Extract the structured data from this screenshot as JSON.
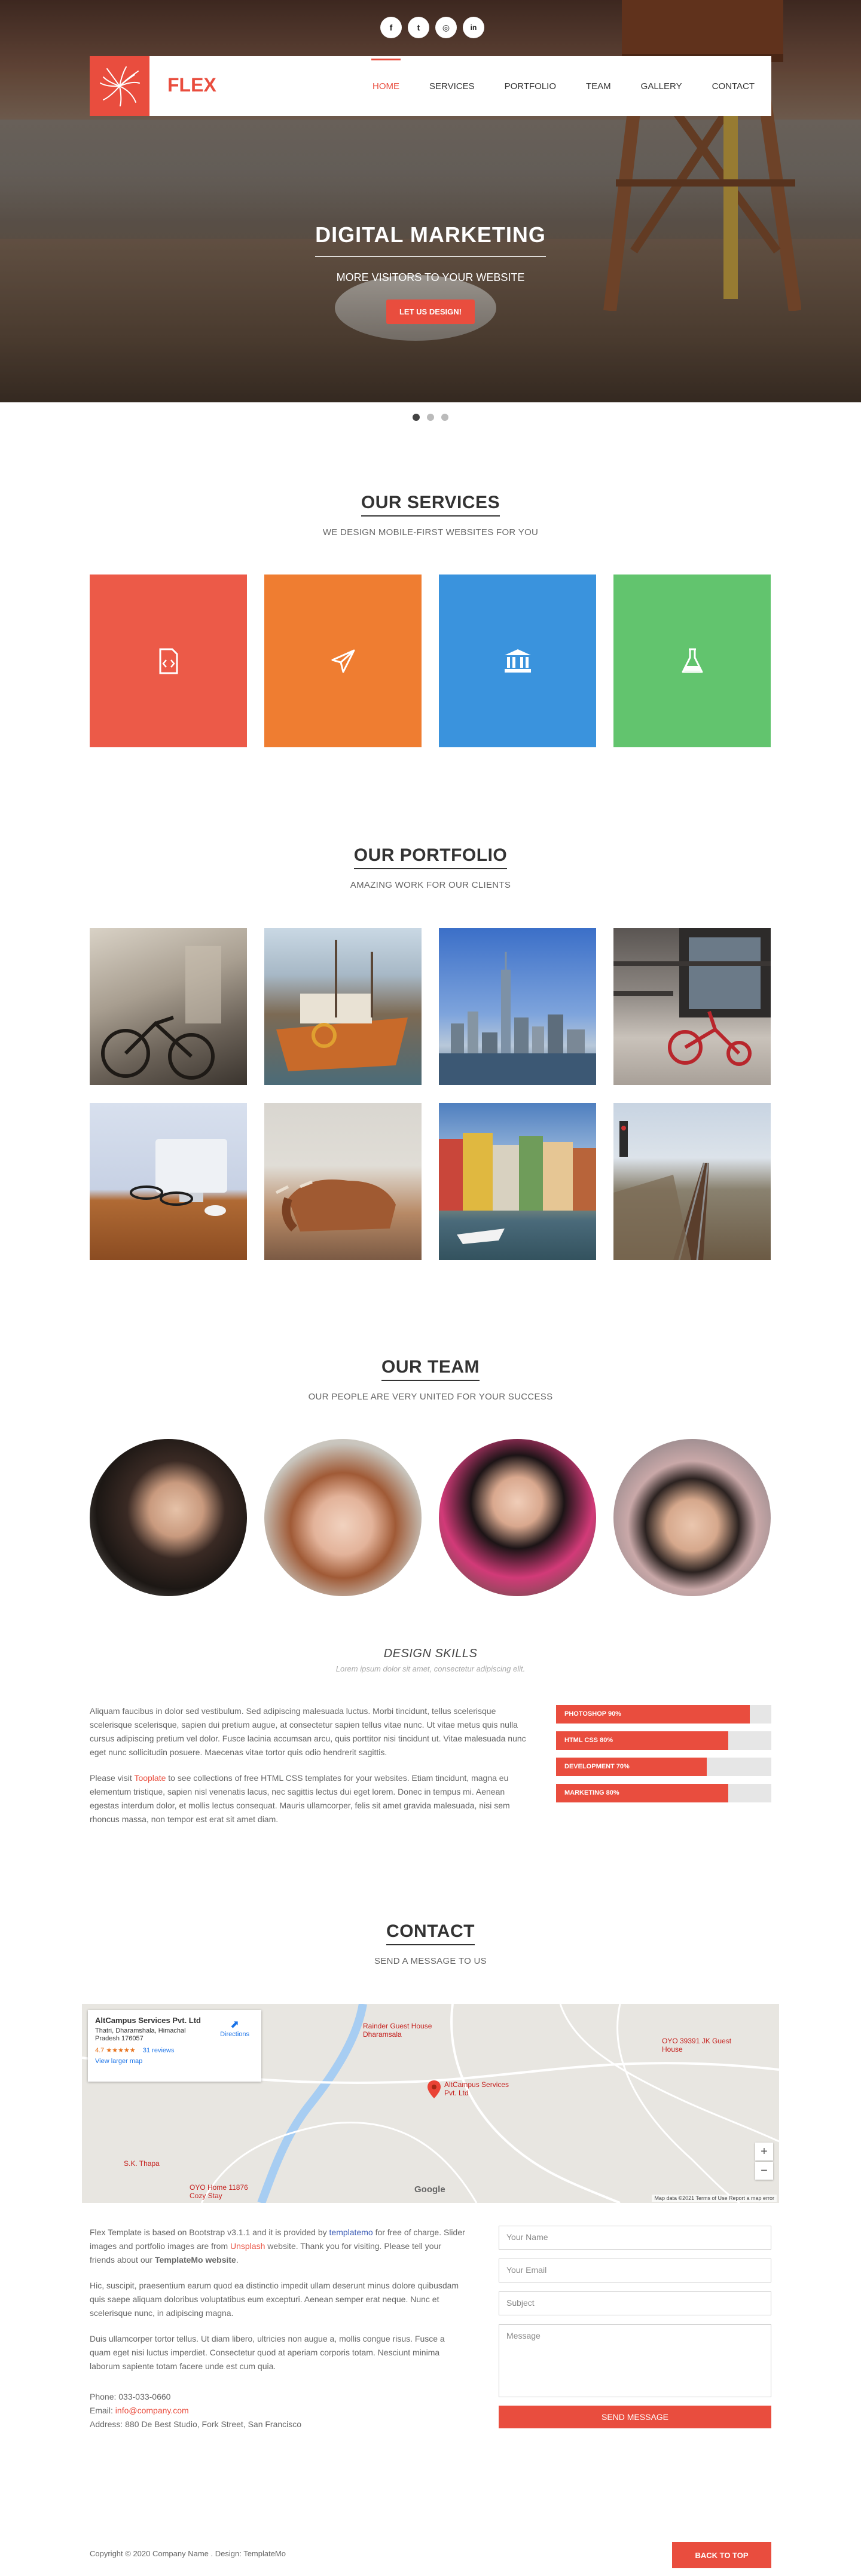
{
  "social": [
    {
      "icon": "facebook-icon",
      "glyph": "f"
    },
    {
      "icon": "twitter-icon",
      "glyph": "t"
    },
    {
      "icon": "dribbble-icon",
      "glyph": "◎"
    },
    {
      "icon": "linkedin-icon",
      "glyph": "in"
    }
  ],
  "nav": {
    "brand": "FLEX",
    "items": [
      "HOME",
      "SERVICES",
      "PORTFOLIO",
      "TEAM",
      "GALLERY",
      "CONTACT"
    ],
    "active": "HOME"
  },
  "hero": {
    "title": "DIGITAL MARKETING",
    "subtitle": "MORE VISITORS TO YOUR WEBSITE",
    "button": "LET US DESIGN!",
    "slides": 3,
    "active_slide": 1
  },
  "services": {
    "title": "OUR SERVICES",
    "subtitle": "WE DESIGN MOBILE-FIRST WEBSITES FOR YOU",
    "tiles": [
      {
        "icon": "code-file-icon",
        "color": "#ec5a48"
      },
      {
        "icon": "paper-plane-icon",
        "color": "#ef7d31"
      },
      {
        "icon": "bank-icon",
        "color": "#3a93dd"
      },
      {
        "icon": "flask-icon",
        "color": "#62c46e"
      }
    ]
  },
  "portfolio": {
    "title": "OUR PORTFOLIO",
    "subtitle": "AMAZING WORK FOR OUR CLIENTS"
  },
  "team": {
    "title": "OUR TEAM",
    "subtitle": "OUR PEOPLE ARE VERY UNITED FOR YOUR SUCCESS"
  },
  "skills": {
    "title": "DESIGN SKILLS",
    "subtitle": "Lorem ipsum dolor sit amet, consectetur adipiscing elit.",
    "para1": "Aliquam faucibus in dolor sed vestibulum. Sed adipiscing malesuada luctus. Morbi tincidunt, tellus scelerisque scelerisque scelerisque, sapien dui pretium augue, at consectetur sapien tellus vitae nunc. Ut vitae metus quis nulla cursus adipiscing pretium vel dolor. Fusce lacinia accumsan arcu, quis porttitor nisi tincidunt ut. Vitae malesuada nunc eget nunc sollicitudin posuere. Maecenas vitae tortor quis odio hendrerit sagittis.",
    "para2_pre": "Please visit ",
    "para2_link": "Tooplate",
    "para2_post": " to see collections of free HTML CSS templates for your websites. Etiam tincidunt, magna eu elementum tristique, sapien nisl venenatis lacus, nec sagittis lectus dui eget lorem. Donec in tempus mi. Aenean egestas interdum dolor, et mollis lectus consequat. Mauris ullamcorper, felis sit amet gravida malesuada, nisi sem rhoncus massa, non tempor est erat sit amet diam.",
    "bars": [
      {
        "label": "PHOTOSHOP 90%",
        "value": 90
      },
      {
        "label": "HTML CSS 80%",
        "value": 80
      },
      {
        "label": "DEVELOPMENT 70%",
        "value": 70
      },
      {
        "label": "MARKETING 80%",
        "value": 80
      }
    ]
  },
  "contact": {
    "title": "CONTACT",
    "subtitle": "SEND A MESSAGE TO US",
    "map": {
      "place": "AltCampus Services Pvt. Ltd",
      "address": "Thatri, Dharamshala, Himachal Pradesh 176057",
      "rating": "4.7 ★★★★★",
      "reviews": "31 reviews",
      "larger": "View larger map",
      "directions": "Directions",
      "marker_label": "AltCampus Services Pvt. Ltd",
      "poi1": "Rainder Guest House Dharamsala",
      "poi2": "OYO 39391 JK Guest House",
      "poi3": "S.K. Thapa",
      "poi4": "OYO Home 11876 Cozy Stay",
      "attribution": "Map data ©2021   Terms of Use   Report a map error",
      "google": "Google",
      "zoom_in": "+",
      "zoom_out": "−"
    },
    "p1_a": "Flex Template is based on Bootstrap v3.1.1 and it is provided by ",
    "p1_link1": "templatemo",
    "p1_b": " for free of charge. Slider images and portfolio images are from ",
    "p1_link2": "Unsplash",
    "p1_c": " website. Thank you for visiting. Please tell your friends about our ",
    "p1_bold": "TemplateMo website",
    "p1_d": ".",
    "p2": "Hic, suscipit, praesentium earum quod ea distinctio impedit ullam deserunt minus dolore quibusdam quis saepe aliquam doloribus voluptatibus eum excepturi. Aenean semper erat neque. Nunc et scelerisque nunc, in adipiscing magna.",
    "p3": "Duis ullamcorper tortor tellus. Ut diam libero, ultricies non augue a, mollis congue risus. Fusce a quam eget nisi luctus imperdiet. Consectetur quod at aperiam corporis totam. Nesciunt minima laborum sapiente totam facere unde est cum quia.",
    "phone": "Phone: 033-033-0660",
    "email_label": "Email: ",
    "email": "info@company.com",
    "address": "Address: 880 De Best Studio, Fork Street, San Francisco",
    "form": {
      "name": "Your Name",
      "email": "Your Email",
      "subject": "Subject",
      "message": "Message",
      "send": "SEND MESSAGE"
    }
  },
  "footer": {
    "copyright": "Copyright © 2020 Company Name . Design: TemplateMo",
    "back_to_top": "BACK TO TOP"
  }
}
